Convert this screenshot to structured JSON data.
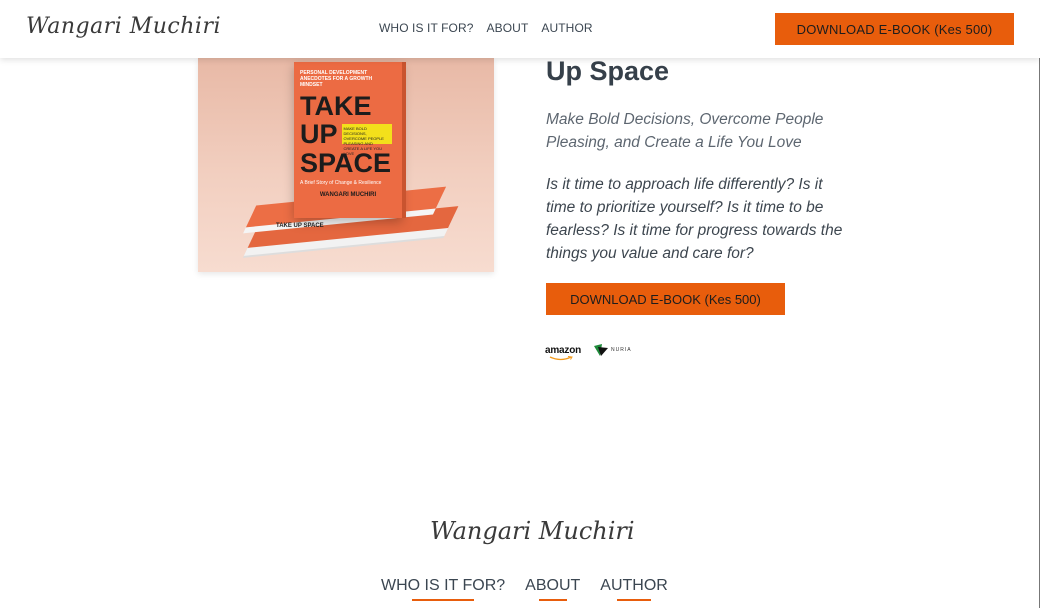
{
  "header": {
    "logo": "Wangari Muchiri",
    "nav": [
      "WHO IS IT FOR?",
      "ABOUT",
      "AUTHOR"
    ],
    "cta_label": "DOWNLOAD E-BOOK (Kes 500)"
  },
  "book": {
    "tagline": "PERSONAL DEVELOPMENT ANECDOTES FOR A GROWTH MINDSET",
    "title_line1": "TAKE",
    "title_line2": "UP",
    "title_line3": "SPACE",
    "yellow_text": "MAKE BOLD DECISIONS, OVERCOME PEOPLE PLEASING AND CREATE A LIFE YOU LOVE",
    "subtitle": "A Brief Story of Change & Resilience",
    "author": "WANGARI MUCHIRI",
    "stack_label": "TAKE UP SPACE"
  },
  "main": {
    "title": "Up Space",
    "subtitle": "Make Bold Decisions, Overcome People Pleasing, and Create a Life You Love",
    "body": "Is it time to approach life differently? Is it time to prioritize yourself? Is it time to be fearless? Is it time for progress towards the things you value and care for?",
    "cta_label": "DOWNLOAD E-BOOK (Kes 500)"
  },
  "retailers": {
    "amazon": "amazon",
    "nuria": "NURIA"
  },
  "footer": {
    "logo": "Wangari Muchiri",
    "nav": [
      "WHO IS IT FOR?",
      "ABOUT",
      "AUTHOR"
    ]
  },
  "colors": {
    "accent": "#e85d0c",
    "text": "#36404a",
    "book_orange": "#ec6b43",
    "book_yellow": "#f3e01b"
  }
}
